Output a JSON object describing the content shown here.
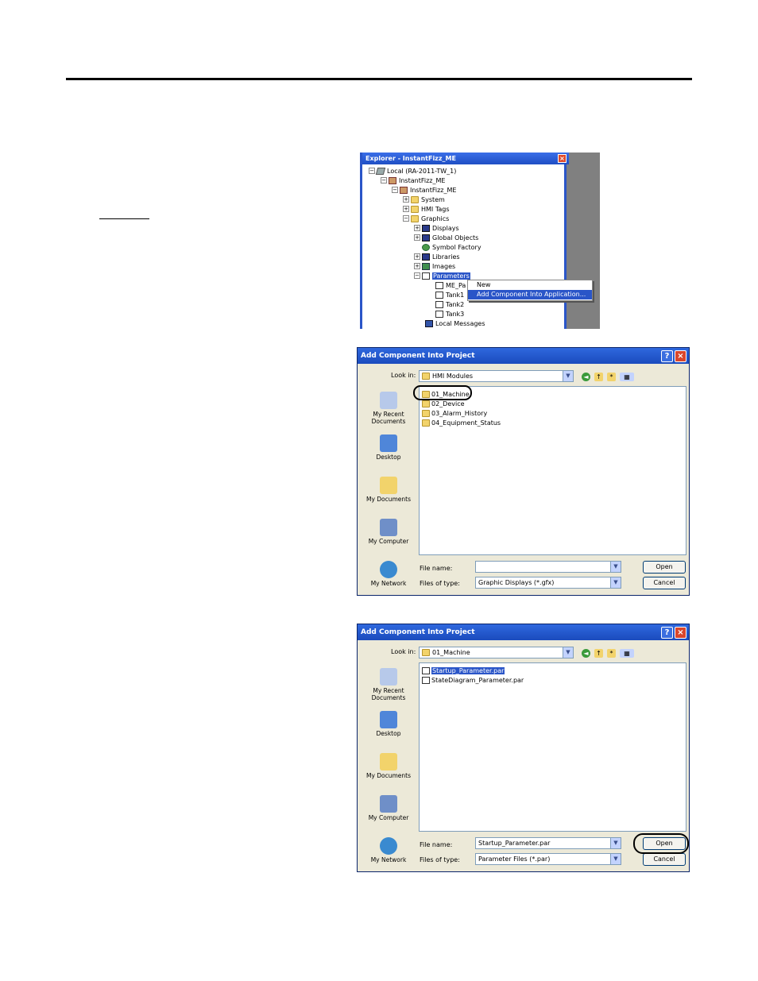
{
  "explorer": {
    "title": "Explorer - InstantFizz_ME",
    "close_glyph": "×",
    "tree": [
      {
        "label": "Local (RA-2011-TW_1)",
        "icon": "network-icon"
      },
      {
        "label": "InstantFizz_ME",
        "icon": "application-icon"
      },
      {
        "label": "InstantFizz_ME",
        "icon": "application-icon"
      },
      {
        "label": "System",
        "icon": "folder-icon"
      },
      {
        "label": "HMI Tags",
        "icon": "folder-icon"
      },
      {
        "label": "Graphics",
        "icon": "folder-open-icon"
      },
      {
        "label": "Displays",
        "icon": "displays-icon"
      },
      {
        "label": "Global Objects",
        "icon": "displays-icon"
      },
      {
        "label": "Symbol Factory",
        "icon": "symbol-factory-icon"
      },
      {
        "label": "Libraries",
        "icon": "displays-icon"
      },
      {
        "label": "Images",
        "icon": "images-icon"
      },
      {
        "label": "Parameters",
        "icon": "document-icon"
      },
      {
        "label": "ME_Pa",
        "icon": "document-icon"
      },
      {
        "label": "Tank1",
        "icon": "document-icon"
      },
      {
        "label": "Tank2",
        "icon": "document-icon"
      },
      {
        "label": "Tank3",
        "icon": "document-icon"
      },
      {
        "label": "Local Messages",
        "icon": "messages-icon"
      }
    ],
    "context_menu": [
      "New",
      "Add Component Into Application..."
    ]
  },
  "dialog1": {
    "title": "Add Component Into Project",
    "lookin_label": "Look in:",
    "lookin_value": "HMI Modules",
    "places": [
      "My Recent Documents",
      "Desktop",
      "My Documents",
      "My Computer",
      "My Network"
    ],
    "files": [
      "01_Machine",
      "02_Device",
      "03_Alarm_History",
      "04_Equipment_Status"
    ],
    "filename_label": "File name:",
    "filename_value": "",
    "filetype_label": "Files of type:",
    "filetype_value": "Graphic Displays (*.gfx)",
    "open_label": "Open",
    "cancel_label": "Cancel"
  },
  "dialog2": {
    "title": "Add Component Into Project",
    "lookin_label": "Look in:",
    "lookin_value": "01_Machine",
    "places": [
      "My Recent Documents",
      "Desktop",
      "My Documents",
      "My Computer",
      "My Network"
    ],
    "files": [
      "Startup_Parameter.par",
      "StateDiagram_Parameter.par"
    ],
    "filename_label": "File name:",
    "filename_value": "Startup_Parameter.par",
    "filetype_label": "Files of type:",
    "filetype_value": "Parameter Files (*.par)",
    "open_label": "Open",
    "cancel_label": "Cancel"
  },
  "colors": {
    "titlebar": "#1f4fc4",
    "selection": "#2a55c8",
    "dialog_bg": "#ece9d8"
  }
}
